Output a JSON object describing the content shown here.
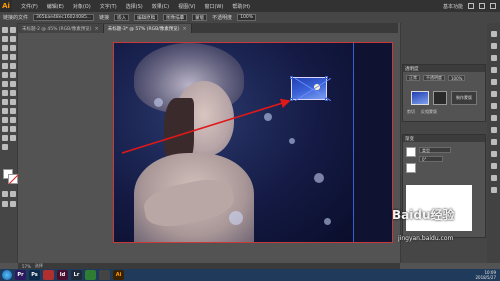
{
  "menubar": {
    "logo": "Ai",
    "items": [
      "文件(F)",
      "编辑(E)",
      "对象(O)",
      "文字(T)",
      "选择(S)",
      "效果(C)",
      "视图(V)",
      "窗口(W)",
      "帮助(H)"
    ],
    "workspace": "基本功能"
  },
  "controlbar": {
    "label": "链接的文件",
    "filename": "365bae48ec16024085...",
    "link_label": "链接",
    "embed_button": "嵌入",
    "edit_button": "编辑原稿",
    "trace_button": "图像描摹",
    "mask_button": "蒙版",
    "opacity_label": "不透明度",
    "opacity_value": "100%"
  },
  "tabs": [
    {
      "label": "未标题-2 @ 45% (RGB/像素预览)",
      "active": false
    },
    {
      "label": "未标题-3* @ 57% (RGB/像素预览)",
      "active": true
    }
  ],
  "transparency_panel": {
    "title": "透明度",
    "mode": "正常",
    "opacity_label": "不透明度",
    "opacity_value": "100%",
    "mask_button": "制作蒙版",
    "clip_label": "剪切",
    "invert_label": "反相蒙版"
  },
  "gradient_panel": {
    "title": "渐变",
    "type_label": "类型",
    "angle_value": "0°"
  },
  "statusbar": {
    "zoom": "57%",
    "tool": "选择"
  },
  "taskbar": {
    "apps": [
      {
        "label": "Pr",
        "color": "#2b1b5e"
      },
      {
        "label": "Ps",
        "color": "#0b2a4a"
      },
      {
        "label": "",
        "color": "#b03030"
      },
      {
        "label": "Id",
        "color": "#4a0f2e"
      },
      {
        "label": "Lr",
        "color": "#1d2a3a"
      },
      {
        "label": "",
        "color": "#2e7d32"
      },
      {
        "label": "",
        "color": "#444444"
      },
      {
        "label": "Ai",
        "color": "#3a2200"
      }
    ],
    "time": "10:09",
    "date": "2018/5/27"
  },
  "watermark": {
    "text": "Baidu经验",
    "url": "jingyan.baidu.com"
  }
}
